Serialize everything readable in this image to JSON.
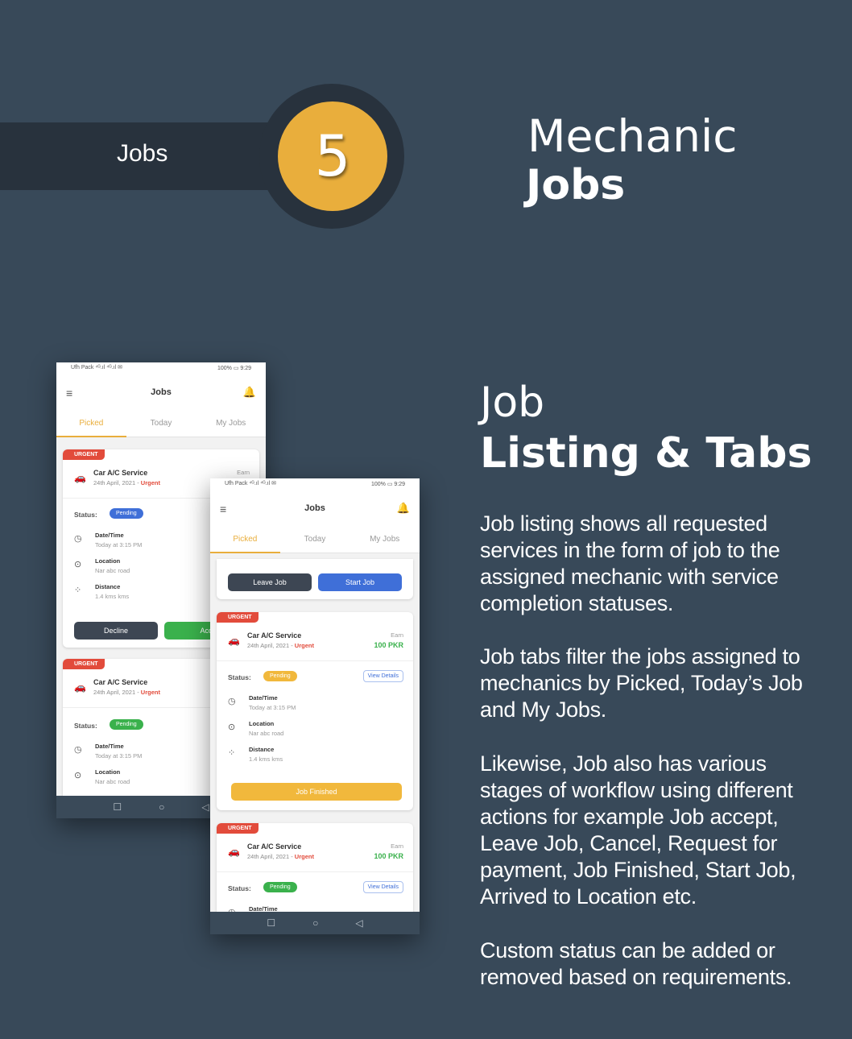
{
  "banner": {
    "label": "Jobs",
    "number": "5"
  },
  "header": {
    "line1": "Mechanic",
    "line2": "Jobs"
  },
  "section": {
    "line1": "Job",
    "line2": "Listing & Tabs"
  },
  "paragraphs": [
    "Job listing shows all requested services in the form of job to the assigned mechanic with service completion statuses.",
    "Job tabs filter the jobs assigned to mechanics by Picked, Today’s Job and My Jobs.",
    "Likewise, Job also has various stages of workflow using different actions for example Job accept, Leave Job, Cancel, Request for payment, Job Finished, Start Job, Arrived to Location etc.",
    "Custom status can be added or removed based on requirements."
  ],
  "colors": {
    "background": "#384959",
    "accent": "#e9ae3c",
    "urgent": "#e24b3b",
    "pending_blue": "#3f6fd8",
    "pending_yellow": "#f1b83c",
    "pending_green": "#3ab14c"
  },
  "phone": {
    "status_left": "Ufh Pack ⁴ᴳ.ıl ⁴ᴳ.ıl ✉",
    "status_right": "100% ▭ 9:29",
    "menu_icon": "≡",
    "title": "Jobs",
    "bell_icon": "🔔",
    "tabs": [
      "Picked",
      "Today",
      "My Jobs"
    ],
    "urgent": "URGENT",
    "service": "Car A/C Service",
    "date": "24th April, 2021 - ",
    "date_urgent": "Urgent",
    "earn": "Earn",
    "earn_value": "100 PKR",
    "status_label": "Status:",
    "pending": "Pending",
    "view_details": "View Details",
    "datetime_label": "Date/Time",
    "datetime_value": "Today at 3:15 PM",
    "location_label": "Location",
    "location_value": "Nar abc road",
    "distance_label": "Distance",
    "distance_value": "1.4 kms kms",
    "decline": "Decline",
    "accept": "Acc",
    "leave_job": "Leave Job",
    "start_job": "Start Job",
    "job_finished": "Job Finished",
    "nav": [
      "☐",
      "○",
      "◁"
    ]
  }
}
